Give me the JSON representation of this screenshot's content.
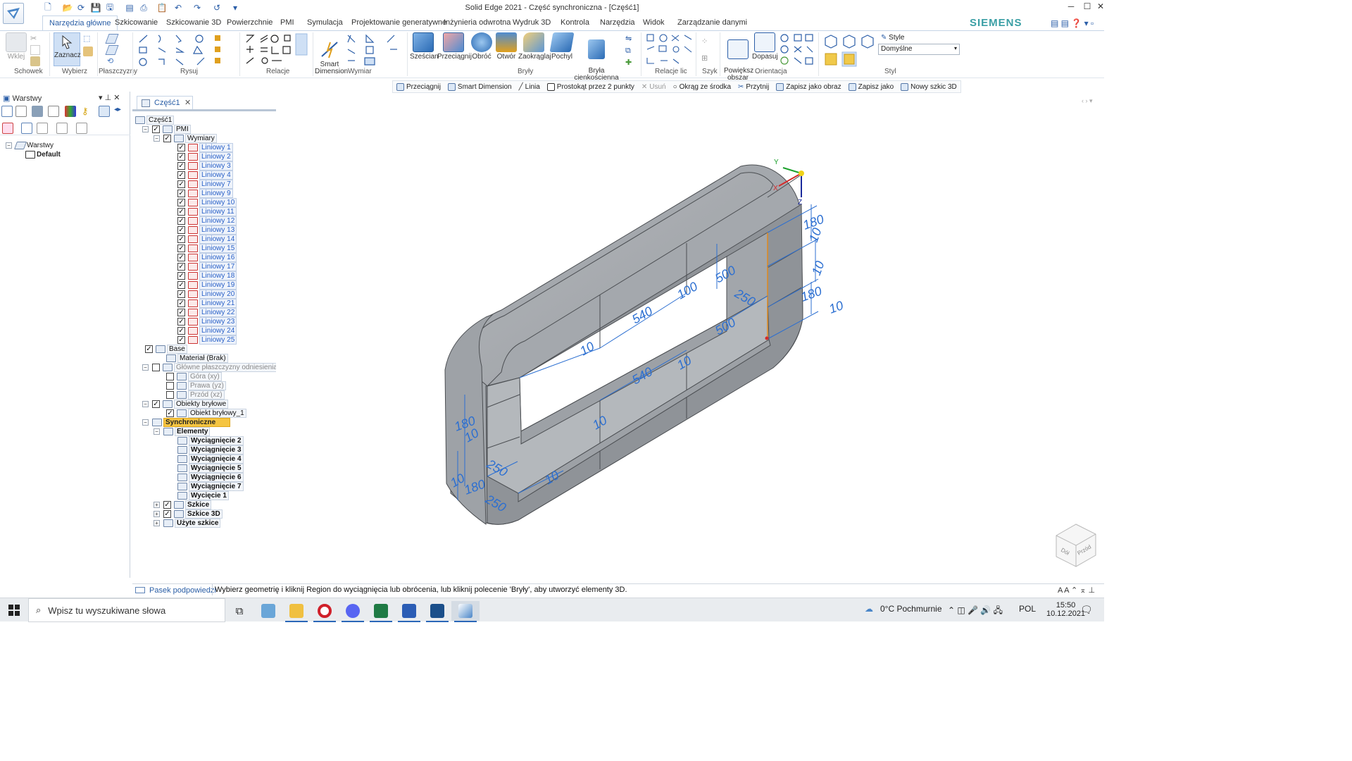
{
  "window": {
    "title": "Solid Edge 2021 - Część synchroniczna - [Część1]"
  },
  "brand": "SIEMENS",
  "tabs": [
    "Narzędzia główne",
    "Szkicowanie",
    "Szkicowanie 3D",
    "Powierzchnie",
    "PMI",
    "Symulacja",
    "Projektowanie generatywne",
    "Inżynieria odwrotna",
    "Wydruk 3D",
    "Kontrola",
    "Narzędzia",
    "Widok",
    "Zarządzanie danymi"
  ],
  "ribbon": {
    "groups": [
      "Schowek",
      "Wybierz",
      "Płaszczyzny",
      "Rysuj",
      "Relacje",
      "Wymiar",
      "Bryły",
      "Relacje lic",
      "Szyk",
      "Orientacja",
      "Styl"
    ],
    "buttons": {
      "paste": "Wklej",
      "select": "Zaznacz",
      "smart_dimension": "Smart\nDimension",
      "box": "Sześcian",
      "extrude": "Przeciągnij",
      "revolve": "Obróć",
      "hole": "Otwór",
      "round": "Zaokrąglaj",
      "draft": "Pochyl",
      "thin_wall": "Bryła\ncienkościenna",
      "zoom_area": "Powiększ\nobszar",
      "fit": "Dopasuj"
    },
    "style_label": "Style",
    "style_value": "Domyślne"
  },
  "command_bar": [
    {
      "label": "Przeciągnij",
      "disabled": false
    },
    {
      "label": "Smart Dimension",
      "disabled": false
    },
    {
      "label": "Linia",
      "disabled": false
    },
    {
      "label": "Prostokąt przez 2 punkty",
      "disabled": false
    },
    {
      "label": "Usuń",
      "disabled": true
    },
    {
      "label": "Okrąg ze środka",
      "disabled": false
    },
    {
      "label": "Przytnij",
      "disabled": false
    },
    {
      "label": "Zapisz jako obraz",
      "disabled": false
    },
    {
      "label": "Zapisz jako",
      "disabled": false
    },
    {
      "label": "Nowy szkic 3D",
      "disabled": false
    }
  ],
  "left_pane": {
    "title": "Warstwy",
    "tree": [
      {
        "label": "Warstwy"
      },
      {
        "label": "Default"
      }
    ]
  },
  "document_tab": "Część1",
  "pathfinder": {
    "root": "Część1",
    "pmi": "PMI",
    "dimensions": "Wymiary",
    "linear": [
      "Liniowy 1",
      "Liniowy 2",
      "Liniowy 3",
      "Liniowy 4",
      "Liniowy 7",
      "Liniowy 9",
      "Liniowy 10",
      "Liniowy 11",
      "Liniowy 12",
      "Liniowy 13",
      "Liniowy 14",
      "Liniowy 15",
      "Liniowy 16",
      "Liniowy 17",
      "Liniowy 18",
      "Liniowy 19",
      "Liniowy 20",
      "Liniowy 21",
      "Liniowy 22",
      "Liniowy 23",
      "Liniowy 24",
      "Liniowy 25"
    ],
    "base": "Base",
    "material": "Materiał (Brak)",
    "ref_planes": "Główne płaszczyzny odniesienia",
    "planes": [
      "Góra (xy)",
      "Prawa (yz)",
      "Przód (xz)"
    ],
    "solids": "Obiekty bryłowe",
    "solid1": "Obiekt bryłowy_1",
    "synchronous": "Synchroniczne",
    "features": "Elementy",
    "feature_items": [
      "Wyciągnięcie 2",
      "Wyciągnięcie 3",
      "Wyciągnięcie 4",
      "Wyciągnięcie 5",
      "Wyciągnięcie 6",
      "Wyciągnięcie 7",
      "Wycięcie 1"
    ],
    "sketches": "Szkice",
    "sketches3d": "Szkice 3D",
    "used_sketches": "Użyte szkice"
  },
  "dimensions_3d": [
    "180",
    "10",
    "10",
    "180",
    "10",
    "500",
    "250",
    "100",
    "540",
    "10",
    "500",
    "540",
    "10",
    "10",
    "180",
    "10",
    "250",
    "10",
    "180",
    "250",
    "10"
  ],
  "triad": {
    "x": "X",
    "y": "Y",
    "z": "Z"
  },
  "viewcube": {
    "face1": "Dół",
    "face2": "Przód"
  },
  "status": {
    "label": "Pasek podpowiedzi",
    "prompt": "Wybierz geometrię i kliknij Region do wyciągnięcia lub obrócenia, lub kliknij polecenie 'Bryły', aby utworzyć elementy 3D."
  },
  "taskbar": {
    "search_placeholder": "Wpisz tu wyszukiwane słowa",
    "weather": "0°C  Pochmurnie",
    "lang": "POL",
    "time": "15:50",
    "date": "10.12.2021"
  },
  "colors": {
    "accent": "#2a5ea6",
    "model": "#a9adb2",
    "dim": "#2c6fd1",
    "highlight": "#f5c542"
  }
}
